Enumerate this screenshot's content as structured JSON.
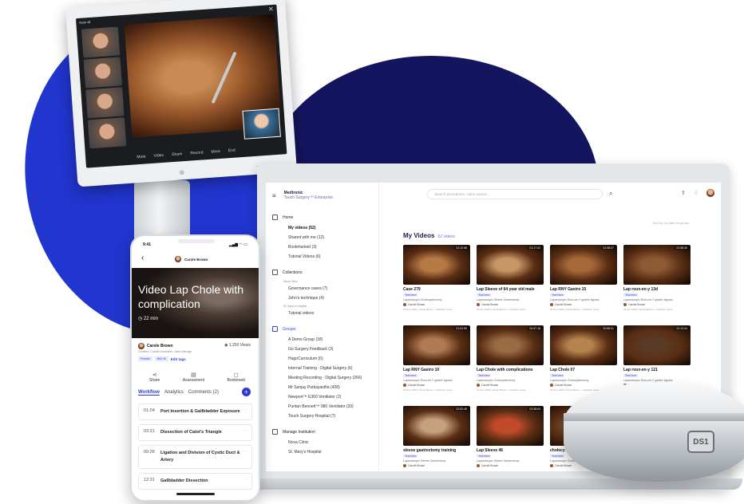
{
  "monitor": {
    "mute_label": "Mute all",
    "participants": [
      "participant-1",
      "participant-2",
      "participant-3",
      "participant-4"
    ],
    "toolbar": [
      "Mute",
      "Video",
      "Share",
      "Record",
      "More",
      "End"
    ]
  },
  "laptop": {
    "brand": {
      "name": "Medtronic",
      "product": "Touch Surgery™ Enterprise"
    },
    "sidebar": {
      "home": "Home",
      "home_items": [
        "My videos (52)",
        "Shared with me (12)",
        "Bookmarked (3)",
        "Tutorial Videos (6)"
      ],
      "collections": "Collections",
      "nova_caption": "Nova Clinic",
      "collection_items": [
        "Governance cases (7)",
        "John's technique (4)"
      ],
      "st_marys_caption": "St. Mary's Hospital",
      "collection_items_2": [
        "Tutorial videos"
      ],
      "groups": "Groups",
      "group_items": [
        "A Demo Group (18)",
        "Go Surgery Feedback (3)",
        "HugoCurriculum (0)",
        "Internal Training - Digital Surgery (6)",
        "Meeting Recording - Digital Surgery (266)",
        "Mr Sanjay Purkayastha (428)",
        "Newport™ E360 Ventilator (2)",
        "Puritan Bennett™ 980 Ventilator (33)",
        "Touch Surgery Hospital (7)"
      ],
      "manage": "Manage Institution",
      "manage_items": [
        "Nova Clinic",
        "St. Mary's Hospital"
      ]
    },
    "search": {
      "placeholder": "Search procedures, video names..."
    },
    "sort_label": "Sort by: by date of upload",
    "section": {
      "title": "My Videos",
      "count": "52 videos"
    },
    "videos": [
      {
        "title": "Case 279",
        "duration": "01:12:58",
        "tag": "Text here",
        "desc": "Laparoscopic Cholecystectomy",
        "author": "Carole Brown",
        "meta": "22 Nov 2018 | Carole Brown · Institution name"
      },
      {
        "title": "Lap Sleeve of 64 year old male",
        "duration": "01:17:02",
        "tag": "Text here",
        "desc": "Laparoscopic Sleeve Gastrectomy",
        "author": "Carole Brown",
        "meta": "22 Nov 2018 | Carole Brown · Institution name"
      },
      {
        "title": "Lap RNY Gastro 15",
        "duration": "01:08:07",
        "tag": "Text here",
        "desc": "Laparoscopic Roux-en-Y gastric bypass",
        "author": "Carole Brown",
        "meta": "22 Nov 2018 | Carole Brown · Institution name"
      },
      {
        "title": "Lap roux-en-y 13d",
        "duration": "01:08:30",
        "tag": "Text here",
        "desc": "Laparoscopic Roux-en-Y gastric bypass",
        "author": "Carole Brown",
        "meta": "22 Nov 2018 | Carole Brown · Institution name"
      },
      {
        "title": "Lap RNY Gastro 10",
        "duration": "01:02:59",
        "tag": "Text here",
        "desc": "Laparoscopic Roux-en-Y gastric bypass",
        "author": "Carole Brown",
        "meta": "22 Nov 2018 | Carole Brown · Institution name"
      },
      {
        "title": "Lap Chole with complications",
        "duration": "00:47:18",
        "tag": "Text here",
        "desc": "Laparoscopic Cholecystectomy",
        "author": "Carole Brown",
        "meta": "11 Nov 2018 | Carole Brown · Institution name"
      },
      {
        "title": "Lap Chole 07",
        "duration": "00:58:01",
        "tag": "Text here",
        "desc": "Laparoscopic Cholecystectomy",
        "author": "Carole Brown",
        "meta": "22 Nov 2018 | Carole Brown · Institution name"
      },
      {
        "title": "Lap roux-en-y 121",
        "duration": "01:12:04",
        "tag": "Text here",
        "desc": "Laparoscopic Roux-en-Y gastric bypass",
        "author": "Carole Brown",
        "meta": "22 Nov 2018 | Carole Brown · Institution name"
      },
      {
        "title": "sleeve gastrectomy training",
        "duration": "02:52:45",
        "tag": "Text here",
        "desc": "Laparoscopic Sleeve Gastrectomy",
        "author": "Carole Brown",
        "meta": ""
      },
      {
        "title": "Lap Sleeve 46",
        "duration": "02:38:04",
        "tag": "Text here",
        "desc": "Laparoscopic Sleeve Gastrectomy",
        "author": "Carole Brown",
        "meta": ""
      },
      {
        "title": "cholecy",
        "duration": "",
        "tag": "Text here",
        "desc": "Laparoscopic Cholecystectomy",
        "author": "Carole Brown",
        "meta": ""
      }
    ]
  },
  "device": {
    "logo": "DS1"
  },
  "phone": {
    "time": "9:41",
    "header_author": "Carole Brown",
    "video_title": "Video Lap Chole with complication",
    "duration": "22 min",
    "author": "Carole Brown",
    "views": "1,250 Views",
    "credits": "Creators: Charlie Kaufmann, Jake Aldmage",
    "tags": [
      "Female",
      "BMI 40"
    ],
    "edit_tags": "Edit tags",
    "actions": [
      "Share",
      "Assessment",
      "Bookmark"
    ],
    "tabs": [
      "Workflow",
      "Analytics",
      "Comments (2)"
    ],
    "steps": [
      {
        "time": "01:04",
        "name": "Port Insertion & Gallbladder Exposure"
      },
      {
        "time": "03:21",
        "name": "Dissection of Calot's Triangle"
      },
      {
        "time": "09:28",
        "name": "Ligation and Division of Cystic Duct & Artery"
      },
      {
        "time": "12:31",
        "name": "Gallbladder Dissection"
      }
    ]
  },
  "colors": {
    "brand_blue": "#2135cf",
    "navy": "#14155f",
    "accent": "#3a45d6"
  }
}
